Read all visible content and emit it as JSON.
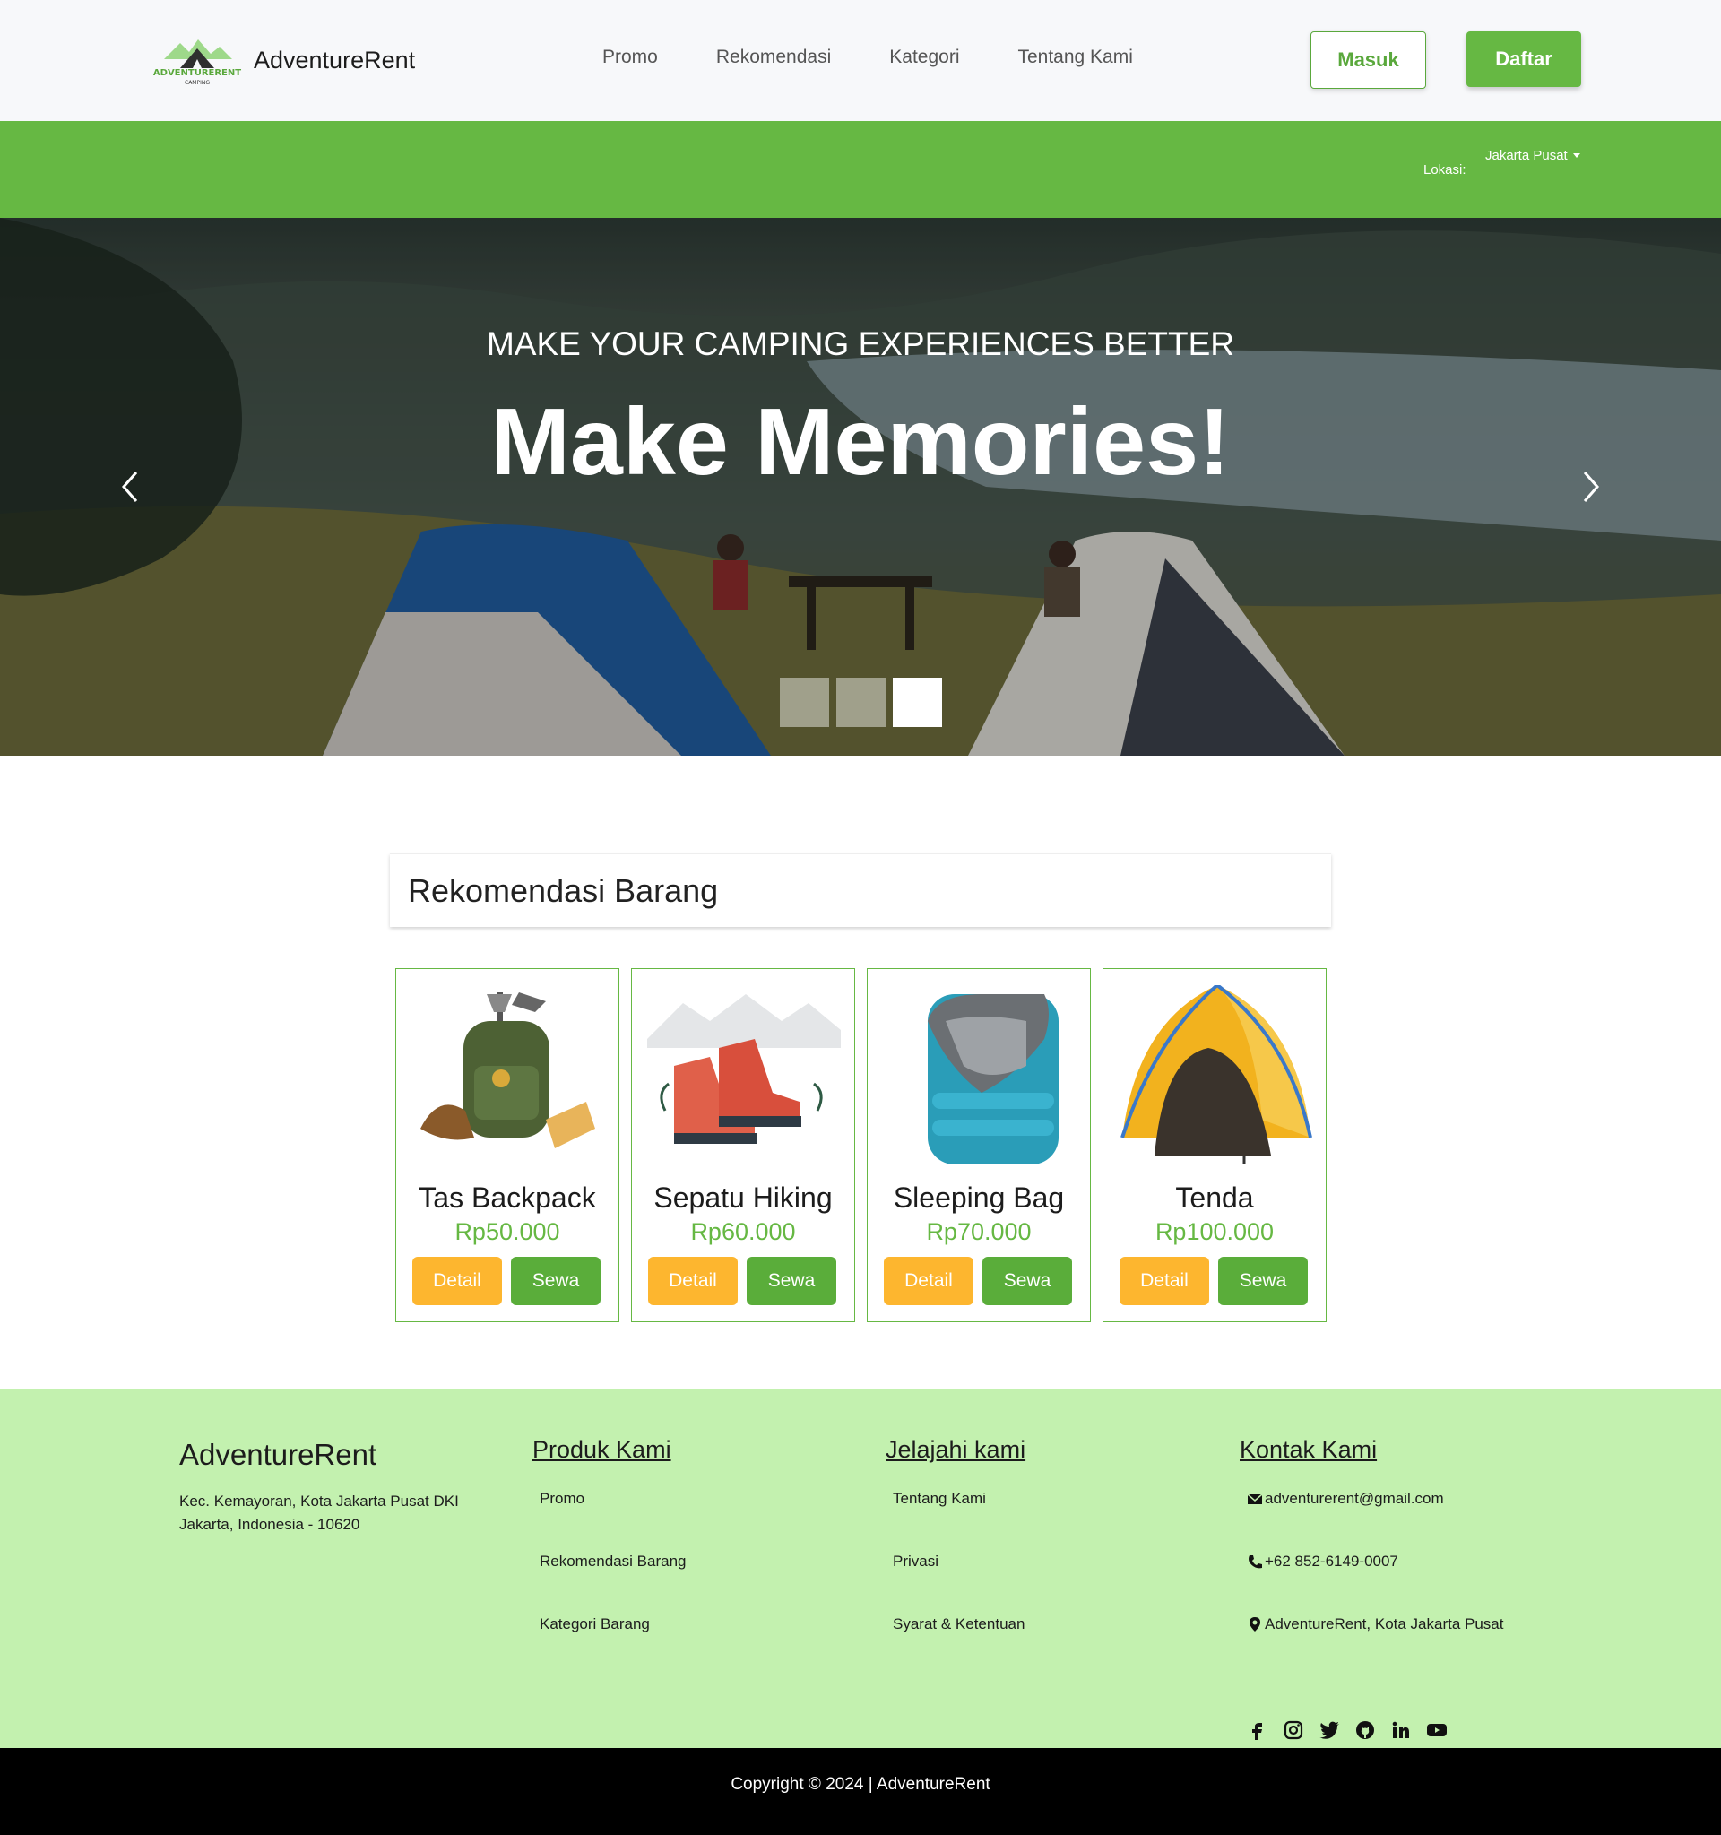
{
  "header": {
    "logo_text": "ADVENTURERENT",
    "logo_subtext": "CAMPING",
    "brand_name": "AdventureRent",
    "nav": [
      "Promo",
      "Rekomendasi",
      "Kategori",
      "Tentang Kami"
    ],
    "login_label": "Masuk",
    "register_label": "Daftar"
  },
  "location": {
    "label": "Lokasi:",
    "selected": "Jakarta Pusat"
  },
  "hero": {
    "subtitle": "MAKE YOUR CAMPING EXPERIENCES BETTER",
    "title": "Make Memories!",
    "slides": 3,
    "active_slide": 3
  },
  "recommendations": {
    "title": "Rekomendasi Barang",
    "detail_label": "Detail",
    "rent_label": "Sewa",
    "items": [
      {
        "name": "Tas Backpack",
        "price": "Rp50.000",
        "icon": "backpack-icon"
      },
      {
        "name": "Sepatu Hiking",
        "price": "Rp60.000",
        "icon": "hiking-boots-icon"
      },
      {
        "name": "Sleeping Bag",
        "price": "Rp70.000",
        "icon": "sleeping-bag-icon"
      },
      {
        "name": "Tenda",
        "price": "Rp100.000",
        "icon": "tent-icon"
      }
    ]
  },
  "footer": {
    "brand": "AdventureRent",
    "address": "Kec. Kemayoran, Kota Jakarta Pusat DKI Jakarta, Indonesia - 10620",
    "products": {
      "title": "Produk Kami",
      "items": [
        "Promo",
        "Rekomendasi Barang",
        "Kategori Barang"
      ]
    },
    "explore": {
      "title": "Jelajahi kami",
      "items": [
        "Tentang Kami",
        "Privasi",
        "Syarat & Ketentuan"
      ]
    },
    "contact": {
      "title": "Kontak Kami",
      "email": "adventurerent@gmail.com",
      "phone": "+62 852-6149-0007",
      "location": "AdventureRent, Kota Jakarta Pusat"
    },
    "socials": [
      "facebook-icon",
      "instagram-icon",
      "twitter-icon",
      "github-icon",
      "linkedin-icon",
      "youtube-icon"
    ],
    "copyright": "Copyright © 2024 | AdventureRent"
  },
  "colors": {
    "brand_green": "#66b843",
    "detail_orange": "#fdb62f",
    "footer_bg": "#c3f1af",
    "copyright_bg": "#000000"
  }
}
